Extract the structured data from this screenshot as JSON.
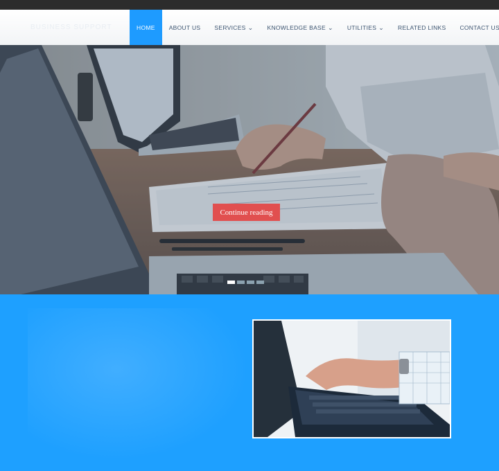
{
  "brand": {
    "logo_text": "BUSINESS SUPPORT"
  },
  "nav": {
    "items": [
      {
        "label": "HOME",
        "active": true,
        "has_dropdown": false,
        "name": "nav-item-home"
      },
      {
        "label": "ABOUT US",
        "active": false,
        "has_dropdown": false,
        "name": "nav-item-about-us"
      },
      {
        "label": "SERVICES",
        "active": false,
        "has_dropdown": true,
        "name": "nav-item-services"
      },
      {
        "label": "KNOWLEDGE BASE",
        "active": false,
        "has_dropdown": true,
        "name": "nav-item-knowledge-base"
      },
      {
        "label": "UTILITIES",
        "active": false,
        "has_dropdown": true,
        "name": "nav-item-utilities"
      },
      {
        "label": "RELATED LINKS",
        "active": false,
        "has_dropdown": false,
        "name": "nav-item-related-links"
      },
      {
        "label": "CONTACT US",
        "active": false,
        "has_dropdown": false,
        "name": "nav-item-contact-us"
      }
    ],
    "chevron_icon": "chevron-down-icon"
  },
  "hero": {
    "cta_label": "Continue reading",
    "slides_count": 4,
    "active_slide": 1
  },
  "colors": {
    "topbar": "#2c2c2c",
    "nav_active": "#1e9bff",
    "nav_text": "#3c5470",
    "cta": "#e14f4f",
    "section_blue": "#1ea0ff"
  }
}
